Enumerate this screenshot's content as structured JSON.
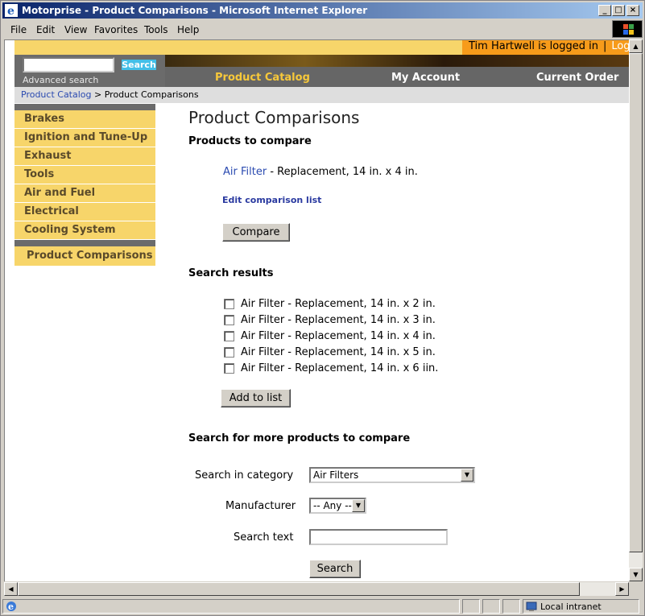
{
  "window": {
    "title": "Motorprise - Product Comparisons - Microsoft Internet Explorer"
  },
  "menu": [
    "File",
    "Edit",
    "View",
    "Favorites",
    "Tools",
    "Help"
  ],
  "header": {
    "logged_in": "Tim Hartwell is logged in",
    "separator": "|",
    "logout_partial": "Log"
  },
  "search": {
    "button": "Search",
    "advanced": "Advanced search"
  },
  "nav": {
    "catalog": "Product Catalog",
    "account": "My Account",
    "order": "Current Order"
  },
  "breadcrumb": {
    "link": "Product Catalog",
    "sep": ">",
    "current": "Product Comparisons"
  },
  "categories": [
    "Brakes",
    "Ignition and Tune-Up",
    "Exhaust",
    "Tools",
    "Air and Fuel",
    "Electrical",
    "Cooling System"
  ],
  "side_current": "Product Comparisons",
  "main": {
    "title": "Product Comparisons",
    "compare_heading": "Products to compare",
    "compare_item_link": "Air Filter",
    "compare_item_rest": " - Replacement, 14 in. x 4 in.",
    "edit_link": "Edit comparison list",
    "compare_button": "Compare",
    "results_heading": "Search results",
    "results": [
      "Air Filter - Replacement, 14 in. x 2 in.",
      "Air Filter - Replacement, 14 in. x 3 in.",
      "Air Filter - Replacement, 14 in. x 4 in.",
      "Air Filter - Replacement, 14 in. x 5 in.",
      "Air Filter - Replacement, 14 in. x 6 iin."
    ],
    "add_button": "Add to list",
    "more_heading": "Search for more products to compare",
    "category_label": "Search in category",
    "category_value": "Air Filters",
    "manufacturer_label": "Manufacturer",
    "manufacturer_value": "-- Any --",
    "text_label": "Search text",
    "text_value": "",
    "search_button": "Search"
  },
  "status": {
    "zone": "Local intranet"
  },
  "icons": [
    "ie-icon",
    "minimize-icon",
    "maximize-icon",
    "close-icon",
    "windows-logo-icon",
    "arrow-up-icon",
    "arrow-down-icon",
    "arrow-left-icon",
    "arrow-right-icon",
    "checkbox-icon",
    "dropdown-arrow-icon",
    "globe-icon"
  ]
}
